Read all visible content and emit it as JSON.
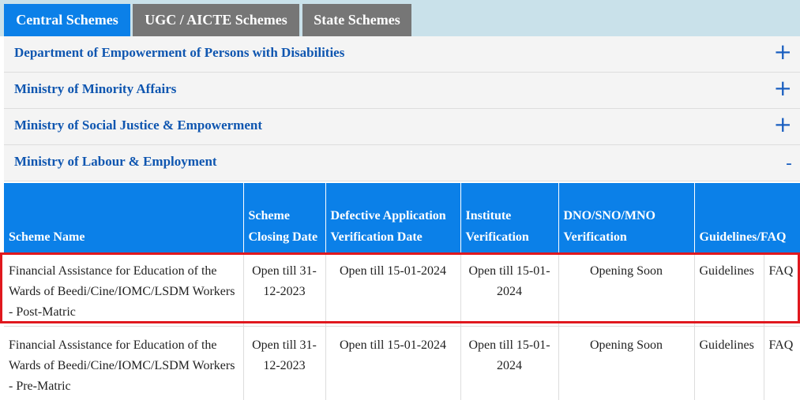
{
  "tabs": [
    {
      "label": "Central Schemes",
      "active": true
    },
    {
      "label": "UGC / AICTE Schemes",
      "active": false
    },
    {
      "label": "State Schemes",
      "active": false
    }
  ],
  "accordion": [
    {
      "title": "Department of Empowerment of Persons with Disabilities",
      "toggle": "+"
    },
    {
      "title": "Ministry of Minority Affairs",
      "toggle": "+"
    },
    {
      "title": "Ministry of Social Justice & Empowerment",
      "toggle": "+"
    },
    {
      "title": "Ministry of Labour & Employment",
      "toggle": "-"
    }
  ],
  "table": {
    "headers": [
      "Scheme Name",
      "Scheme Closing Date",
      "Defective Application Verification Date",
      "Institute Verification",
      "DNO/SNO/MNO Verification",
      "Guidelines/FAQ"
    ],
    "rows": [
      {
        "name": "Financial Assistance for Education of the Wards of Beedi/Cine/IOMC/LSDM Workers - Post-Matric",
        "closing": "Open till 31-12-2023",
        "defective": "Open till 15-01-2024",
        "institute": "Open till 15-01-2024",
        "dno": "Opening Soon",
        "guidelines": "Guidelines",
        "faq": "FAQ"
      },
      {
        "name": "Financial Assistance for Education of the Wards of Beedi/Cine/IOMC/LSDM Workers - Pre-Matric",
        "closing": "Open till 31-12-2023",
        "defective": "Open till 15-01-2024",
        "institute": "Open till 15-01-2024",
        "dno": "Opening Soon",
        "guidelines": "Guidelines",
        "faq": "FAQ"
      }
    ]
  },
  "colors": {
    "tab_active": "#0b80e8",
    "tab_inactive": "#767676",
    "header_bg": "#0b80e8",
    "accordion_title": "#0f56b0",
    "status_open": "#1a7d17",
    "status_soon": "#d62c36",
    "link": "#1f6fd0",
    "highlight": "#e0181e"
  }
}
